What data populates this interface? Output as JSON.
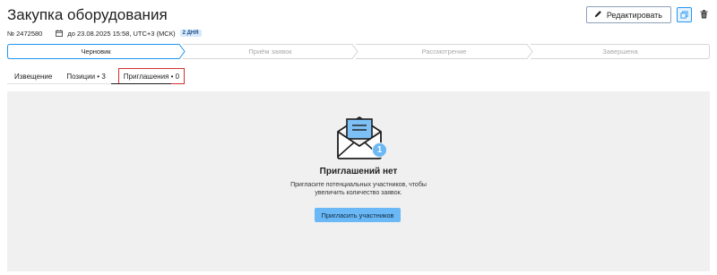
{
  "page": {
    "title": "Закупка оборудования"
  },
  "toolbar": {
    "edit_label": "Редактировать",
    "edit_icon": "pencil-icon",
    "copy_icon": "copy-icon",
    "delete_icon": "trash-icon"
  },
  "meta": {
    "number": "№ 2472580",
    "deadline": "до 23.08.2025 15:58, UTC+3 (МСК)",
    "days_badge": "2 ДНЯ"
  },
  "stepper": {
    "steps": [
      {
        "label": "Черновик",
        "state": "active"
      },
      {
        "label": "Приём заявок",
        "state": "pending"
      },
      {
        "label": "Рассмотрение",
        "state": "pending"
      },
      {
        "label": "Завершена",
        "state": "pending"
      }
    ],
    "active_color": "#2196f3"
  },
  "tabs": [
    {
      "label": "Извещение"
    },
    {
      "label": "Позиции • 3"
    },
    {
      "label": "Приглашения • 0",
      "active": true
    }
  ],
  "empty_state": {
    "badge_count": "1",
    "title": "Приглашений нет",
    "description_line1": "Пригласите потенциальных участников, чтобы",
    "description_line2": "увеличить количество заявок.",
    "button_label": "Пригласить участников"
  }
}
